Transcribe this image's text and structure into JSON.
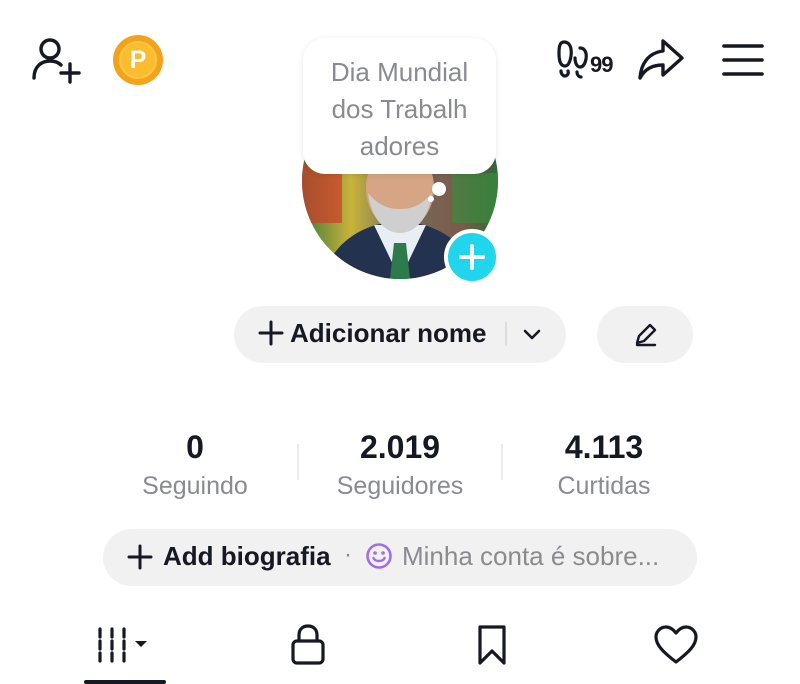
{
  "header": {
    "add_friend_icon": "person-add-icon",
    "points_badge": "P",
    "profile_views_count": "99",
    "share_icon": "share-arrow-icon",
    "menu_icon": "hamburger-menu-icon"
  },
  "note": {
    "text": "Dia Mundial\ndos Trabalh\nadores"
  },
  "avatar": {
    "add_icon": "plus-icon",
    "accent_color": "#20d5ec"
  },
  "name_row": {
    "add_name_label": "Adicionar nome",
    "edit_icon": "pencil-icon"
  },
  "stats": [
    {
      "value": "0",
      "label": "Seguindo"
    },
    {
      "value": "2.019",
      "label": "Seguidores"
    },
    {
      "value": "4.113",
      "label": "Curtidas"
    }
  ],
  "bio": {
    "add_label": "Add biografia",
    "separator": "·",
    "placeholder": "Minha conta é sobre...",
    "smile_color": "#a26bf0"
  },
  "tabs": [
    {
      "icon": "videos-grid-icon",
      "active": true
    },
    {
      "icon": "lock-icon",
      "active": false
    },
    {
      "icon": "bookmark-icon",
      "active": false
    },
    {
      "icon": "heart-icon",
      "active": false
    }
  ],
  "colors": {
    "text_primary": "#161823",
    "text_secondary": "#8a8b91",
    "pill_background": "#f1f1f2",
    "points_orange": "#f4a21a"
  }
}
